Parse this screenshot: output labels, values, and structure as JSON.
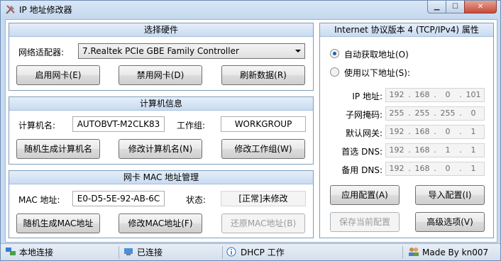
{
  "window": {
    "title": "IP 地址修改器"
  },
  "hardware": {
    "header": "选择硬件",
    "adapter_label": "网络适配器:",
    "adapter_value": "7.Realtek PCIe GBE Family Controller",
    "btn_enable": "启用网卡(E)",
    "btn_disable": "禁用网卡(D)",
    "btn_refresh": "刷新数据(R)"
  },
  "computer": {
    "header": "计算机信息",
    "name_label": "计算机名:",
    "name_value": "AUTOBVT-M2CLK83",
    "workgroup_label": "工作组:",
    "workgroup_value": "WORKGROUP",
    "btn_random_name": "随机生成计算机名",
    "btn_change_name": "修改计算机名(N)",
    "btn_change_workgroup": "修改工作组(W)"
  },
  "mac": {
    "header": "网卡 MAC 地址管理",
    "mac_label": "MAC 地址:",
    "mac_value": "E0-D5-5E-92-AB-6C",
    "status_label": "状态:",
    "status_value": "[正常]未修改",
    "btn_random_mac": "随机生成MAC地址",
    "btn_change_mac": "修改MAC地址(F)",
    "btn_restore_mac": "还原MAC地址(B)"
  },
  "ipv4": {
    "header": "Internet 协议版本 4 (TCP/IPv4) 属性",
    "radio_auto": "自动获取地址(O)",
    "radio_manual": "使用以下地址(S):",
    "selected": "auto",
    "ip_label": "IP 地址:",
    "ip": [
      "192",
      "168",
      "0",
      "101"
    ],
    "mask_label": "子网掩码:",
    "mask": [
      "255",
      "255",
      "255",
      "0"
    ],
    "gateway_label": "默认网关:",
    "gateway": [
      "192",
      "168",
      "0",
      "1"
    ],
    "dns1_label": "首选 DNS:",
    "dns1": [
      "192",
      "168",
      "1",
      "1"
    ],
    "dns2_label": "备用 DNS:",
    "dns2": [
      "192",
      "168",
      "0",
      "1"
    ],
    "btn_apply": "应用配置(A)",
    "btn_import": "导入配置(I)",
    "btn_save": "保存当前配置",
    "btn_advanced": "高级选项(V)"
  },
  "statusbar": {
    "connection": "本地连接",
    "state": "已连接",
    "mode": "DHCP 工作",
    "author": "Made By kn007"
  }
}
